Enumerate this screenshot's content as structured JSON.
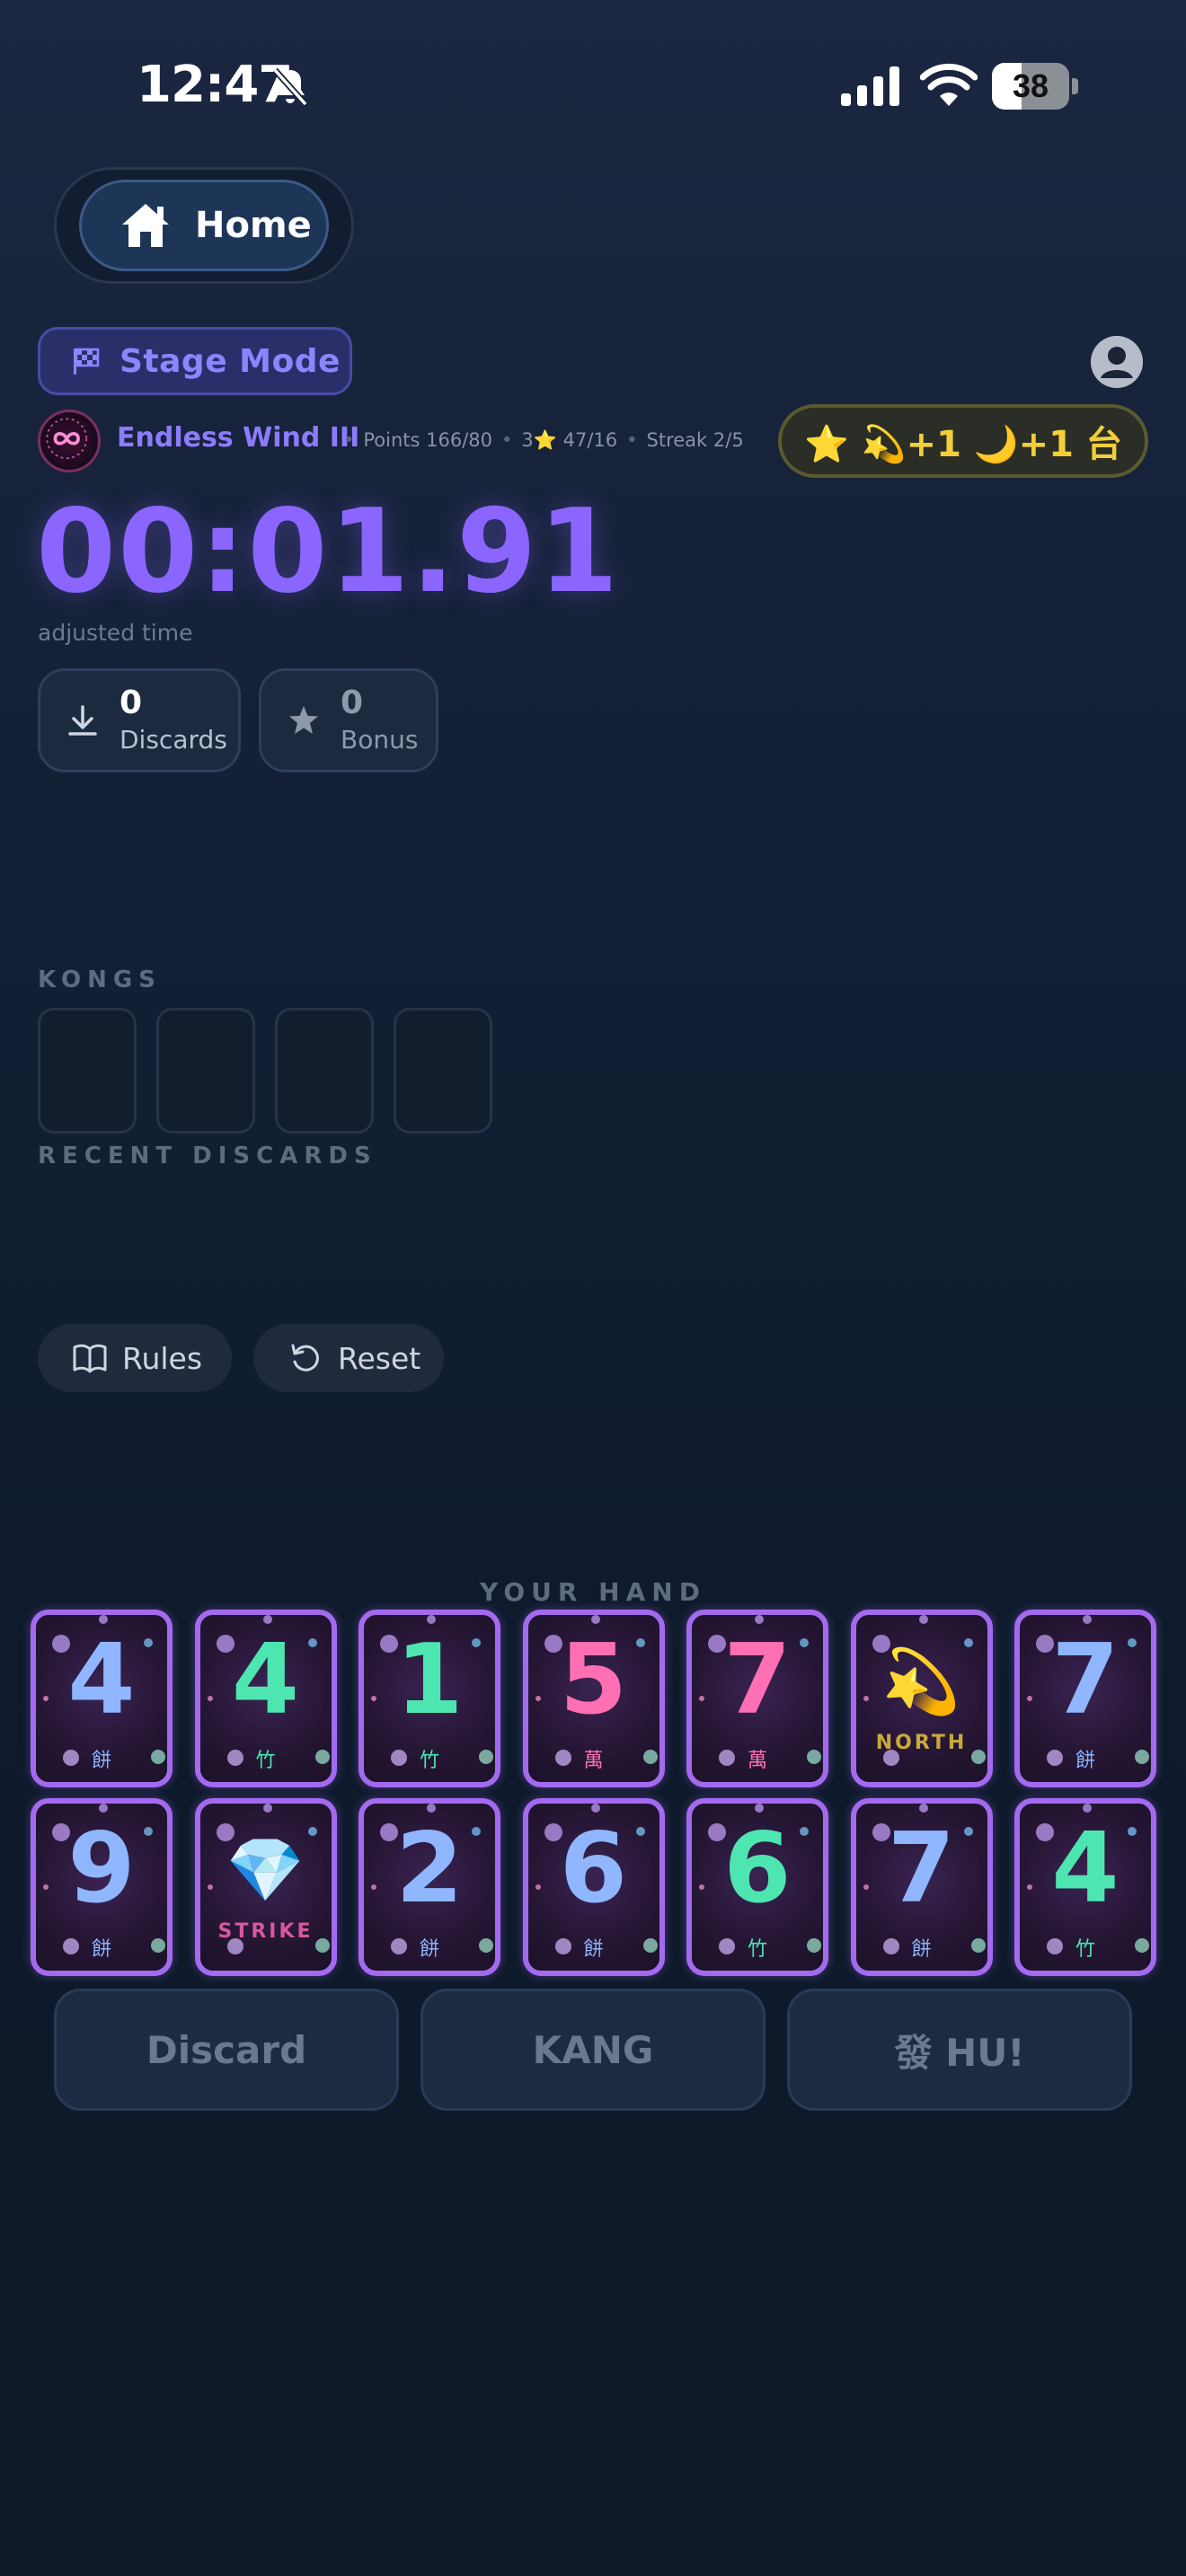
{
  "status_bar": {
    "time": "12:47",
    "battery": "38",
    "battery_level": 0.38
  },
  "nav": {
    "home_label": "Home"
  },
  "mode": {
    "label": "Stage Mode"
  },
  "stage": {
    "name": "Endless Wind III",
    "separator": "•",
    "points": "Points 166/80",
    "stars": "3⭐ 47/16",
    "streak": "Streak 2/5"
  },
  "bonus_pill": "⭐ 💫+1 🌙+1 台",
  "timer": {
    "value": "00:01.91",
    "caption": "adjusted time"
  },
  "stats": {
    "discards": {
      "value": "0",
      "label": "Discards"
    },
    "bonus": {
      "value": "0",
      "label": "Bonus"
    }
  },
  "sections": {
    "kongs": "KONGS",
    "recent_discards": "RECENT DISCARDS",
    "your_hand": "YOUR HAND"
  },
  "controls": {
    "rules": "Rules",
    "reset": "Reset"
  },
  "hand": {
    "row1": [
      {
        "value": "4",
        "suit": "餅",
        "color": "#8fb6ff"
      },
      {
        "value": "4",
        "suit": "竹",
        "color": "#4ee6b0"
      },
      {
        "value": "1",
        "suit": "竹",
        "color": "#4ee6b0"
      },
      {
        "value": "5",
        "suit": "萬",
        "color": "#ff6fb3"
      },
      {
        "value": "7",
        "suit": "萬",
        "color": "#ff6fb3"
      },
      {
        "emoji": "💫",
        "word": "NORTH",
        "color": "#c9a93b"
      },
      {
        "value": "7",
        "suit": "餅",
        "color": "#8fb6ff"
      }
    ],
    "row2": [
      {
        "value": "9",
        "suit": "餅",
        "color": "#8fb6ff"
      },
      {
        "emoji": "💎",
        "word": "STRIKE",
        "color": "#d8579c"
      },
      {
        "value": "2",
        "suit": "餅",
        "color": "#8fb6ff"
      },
      {
        "value": "6",
        "suit": "餅",
        "color": "#8fb6ff"
      },
      {
        "value": "6",
        "suit": "竹",
        "color": "#4ee6b0"
      },
      {
        "value": "7",
        "suit": "餅",
        "color": "#8fb6ff"
      },
      {
        "value": "4",
        "suit": "竹",
        "color": "#4ee6b0"
      }
    ]
  },
  "actions": {
    "discard": "Discard",
    "kang": "KANG",
    "hu": "發 HU!"
  }
}
